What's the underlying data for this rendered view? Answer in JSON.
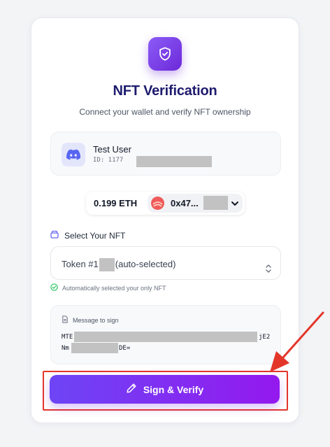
{
  "header": {
    "title": "NFT Verification",
    "subtitle": "Connect your wallet and verify NFT ownership"
  },
  "user": {
    "name": "Test User",
    "id_prefix": "ID: 1177"
  },
  "wallet": {
    "balance": "0.199 ETH",
    "address_prefix": "0x47..."
  },
  "nft_select": {
    "label": "Select Your NFT",
    "value_prefix": "Token #1",
    "value_suffix": "(auto-selected)",
    "hint": "Automatically selected your only NFT"
  },
  "message": {
    "label": "Message to sign",
    "line1_start": "MTE",
    "line1_end": "jE2",
    "line2_start": "Nm",
    "line2_end": "DE="
  },
  "action": {
    "sign_label": "Sign & Verify"
  },
  "colors": {
    "accent": "#7c3aed",
    "title": "#1e1b6e",
    "annotation": "#e4352a",
    "success": "#22c55e"
  }
}
